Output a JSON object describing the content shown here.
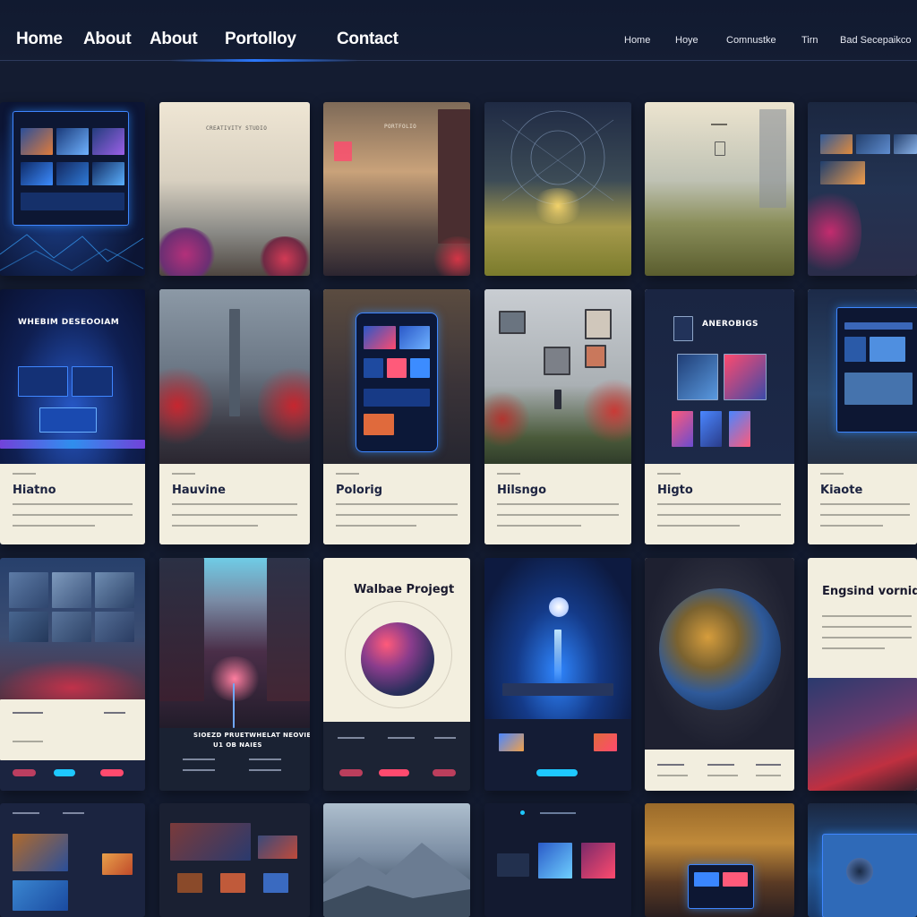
{
  "nav": {
    "primary": [
      "Home",
      "About",
      "About",
      "Portolloy",
      "Contact"
    ],
    "utility": [
      "Home",
      "Hoye",
      "Comnustke",
      "Tirn",
      "Bad Secepaikco"
    ]
  },
  "cards": {
    "r1": {
      "c2_caption": "CREATIVITY STUDIO",
      "c3_caption": "PORTFOLIO"
    },
    "r2": {
      "c1_overlay": "WHEBIM DESEOOIAM",
      "c5_overlay": "ANEROBIGS",
      "titles": [
        "Hiatno",
        "Hauvine",
        "Polorig",
        "Hilsngo",
        "Higto",
        "Kiaote"
      ]
    },
    "r3": {
      "c2_caption_line1": "SIOEZD PRUETWHELAT NEOVIE",
      "c2_caption_line2": "U1 OB NAIES",
      "c3_title": "Walbae Projegt",
      "c6_title": "Engsind vornide"
    }
  },
  "colors": {
    "background": "#141c31",
    "nav_accent": "#2b78ff",
    "card_cream": "#f2eedf",
    "card_title": "#1c2340",
    "neon_blue": "#3f86ff",
    "neon_pink": "#ff4a6e",
    "neon_cyan": "#1ec8ff"
  }
}
